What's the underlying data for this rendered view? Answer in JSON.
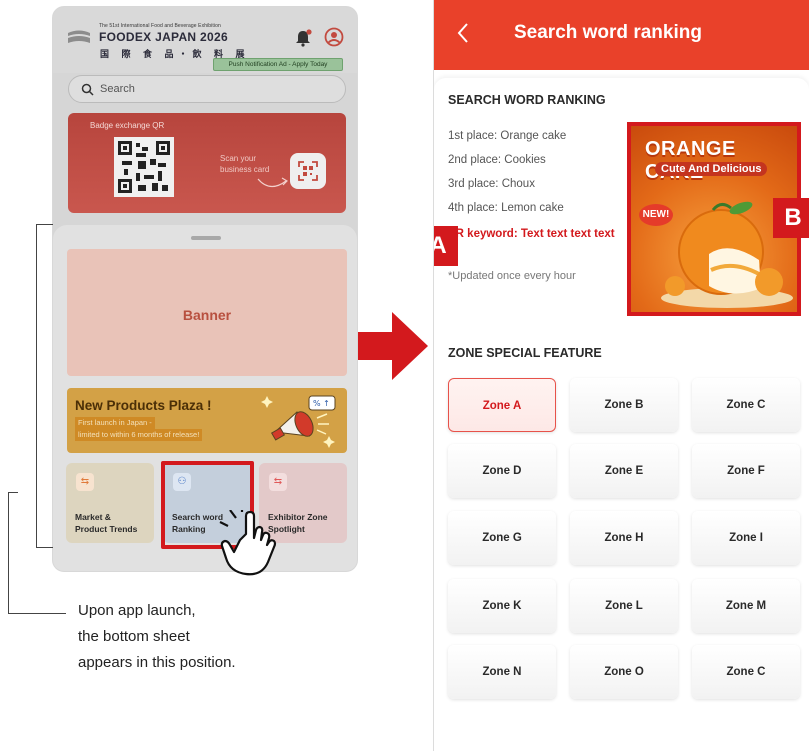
{
  "left_app": {
    "logo_small": "The 51st International Food and Beverage Exhibition",
    "logo_title": "FOODEX JAPAN 2026",
    "logo_sub": "国 際 食 品・飲 料 展",
    "push_notification": "Push Notification Ad - Apply Today",
    "search_placeholder": "Search",
    "badge_title": "Badge exchange QR",
    "scan_text_1": "Scan your",
    "scan_text_2": "business card",
    "banner_label": "Banner",
    "plaza_title": "New Products Plaza !",
    "plaza_sub_1": "First launch in Japan -",
    "plaza_sub_2": "limited to within 6 months of release!",
    "cards": [
      {
        "label_1": "Market &",
        "label_2": "Product Trends",
        "icon": "arrows-swap-icon",
        "color": "#e07a3a"
      },
      {
        "label_1": "Search word",
        "label_2": "Ranking",
        "icon": "ranking-icon",
        "color": "#4a78c4"
      },
      {
        "label_1": "Exhibitor Zone",
        "label_2": "Spotlight",
        "icon": "arrows-swap-icon",
        "color": "#e05a5a"
      }
    ]
  },
  "caption": {
    "line_1": "Upon app launch,",
    "line_2": "the bottom sheet",
    "line_3": "appears in this position."
  },
  "right_app": {
    "title": "Search word ranking",
    "section_ranking": "SEARCH WORD RANKING",
    "rankings": [
      "1st place: Orange cake",
      "2nd place: Cookies",
      "3rd place: Choux",
      "4th place: Lemon cake"
    ],
    "pr_keyword": "PR keyword: Text text text text",
    "updated_note": "*Updated once every hour",
    "ad_title": "ORANGE CAKE",
    "ad_sub": "Cute And Delicious",
    "ad_badge": "NEW!",
    "section_zone": "ZONE SPECIAL FEATURE",
    "zones": [
      "Zone A",
      "Zone B",
      "Zone C",
      "Zone D",
      "Zone E",
      "Zone F",
      "Zone G",
      "Zone H",
      "Zone I",
      "Zone K",
      "Zone L",
      "Zone M",
      "Zone N",
      "Zone O",
      "Zone C"
    ],
    "active_zone": "Zone A"
  },
  "annotations": {
    "label_a": "A",
    "label_b": "B"
  },
  "colors": {
    "accent_red": "#d3191d",
    "header_red": "#e9412a"
  }
}
